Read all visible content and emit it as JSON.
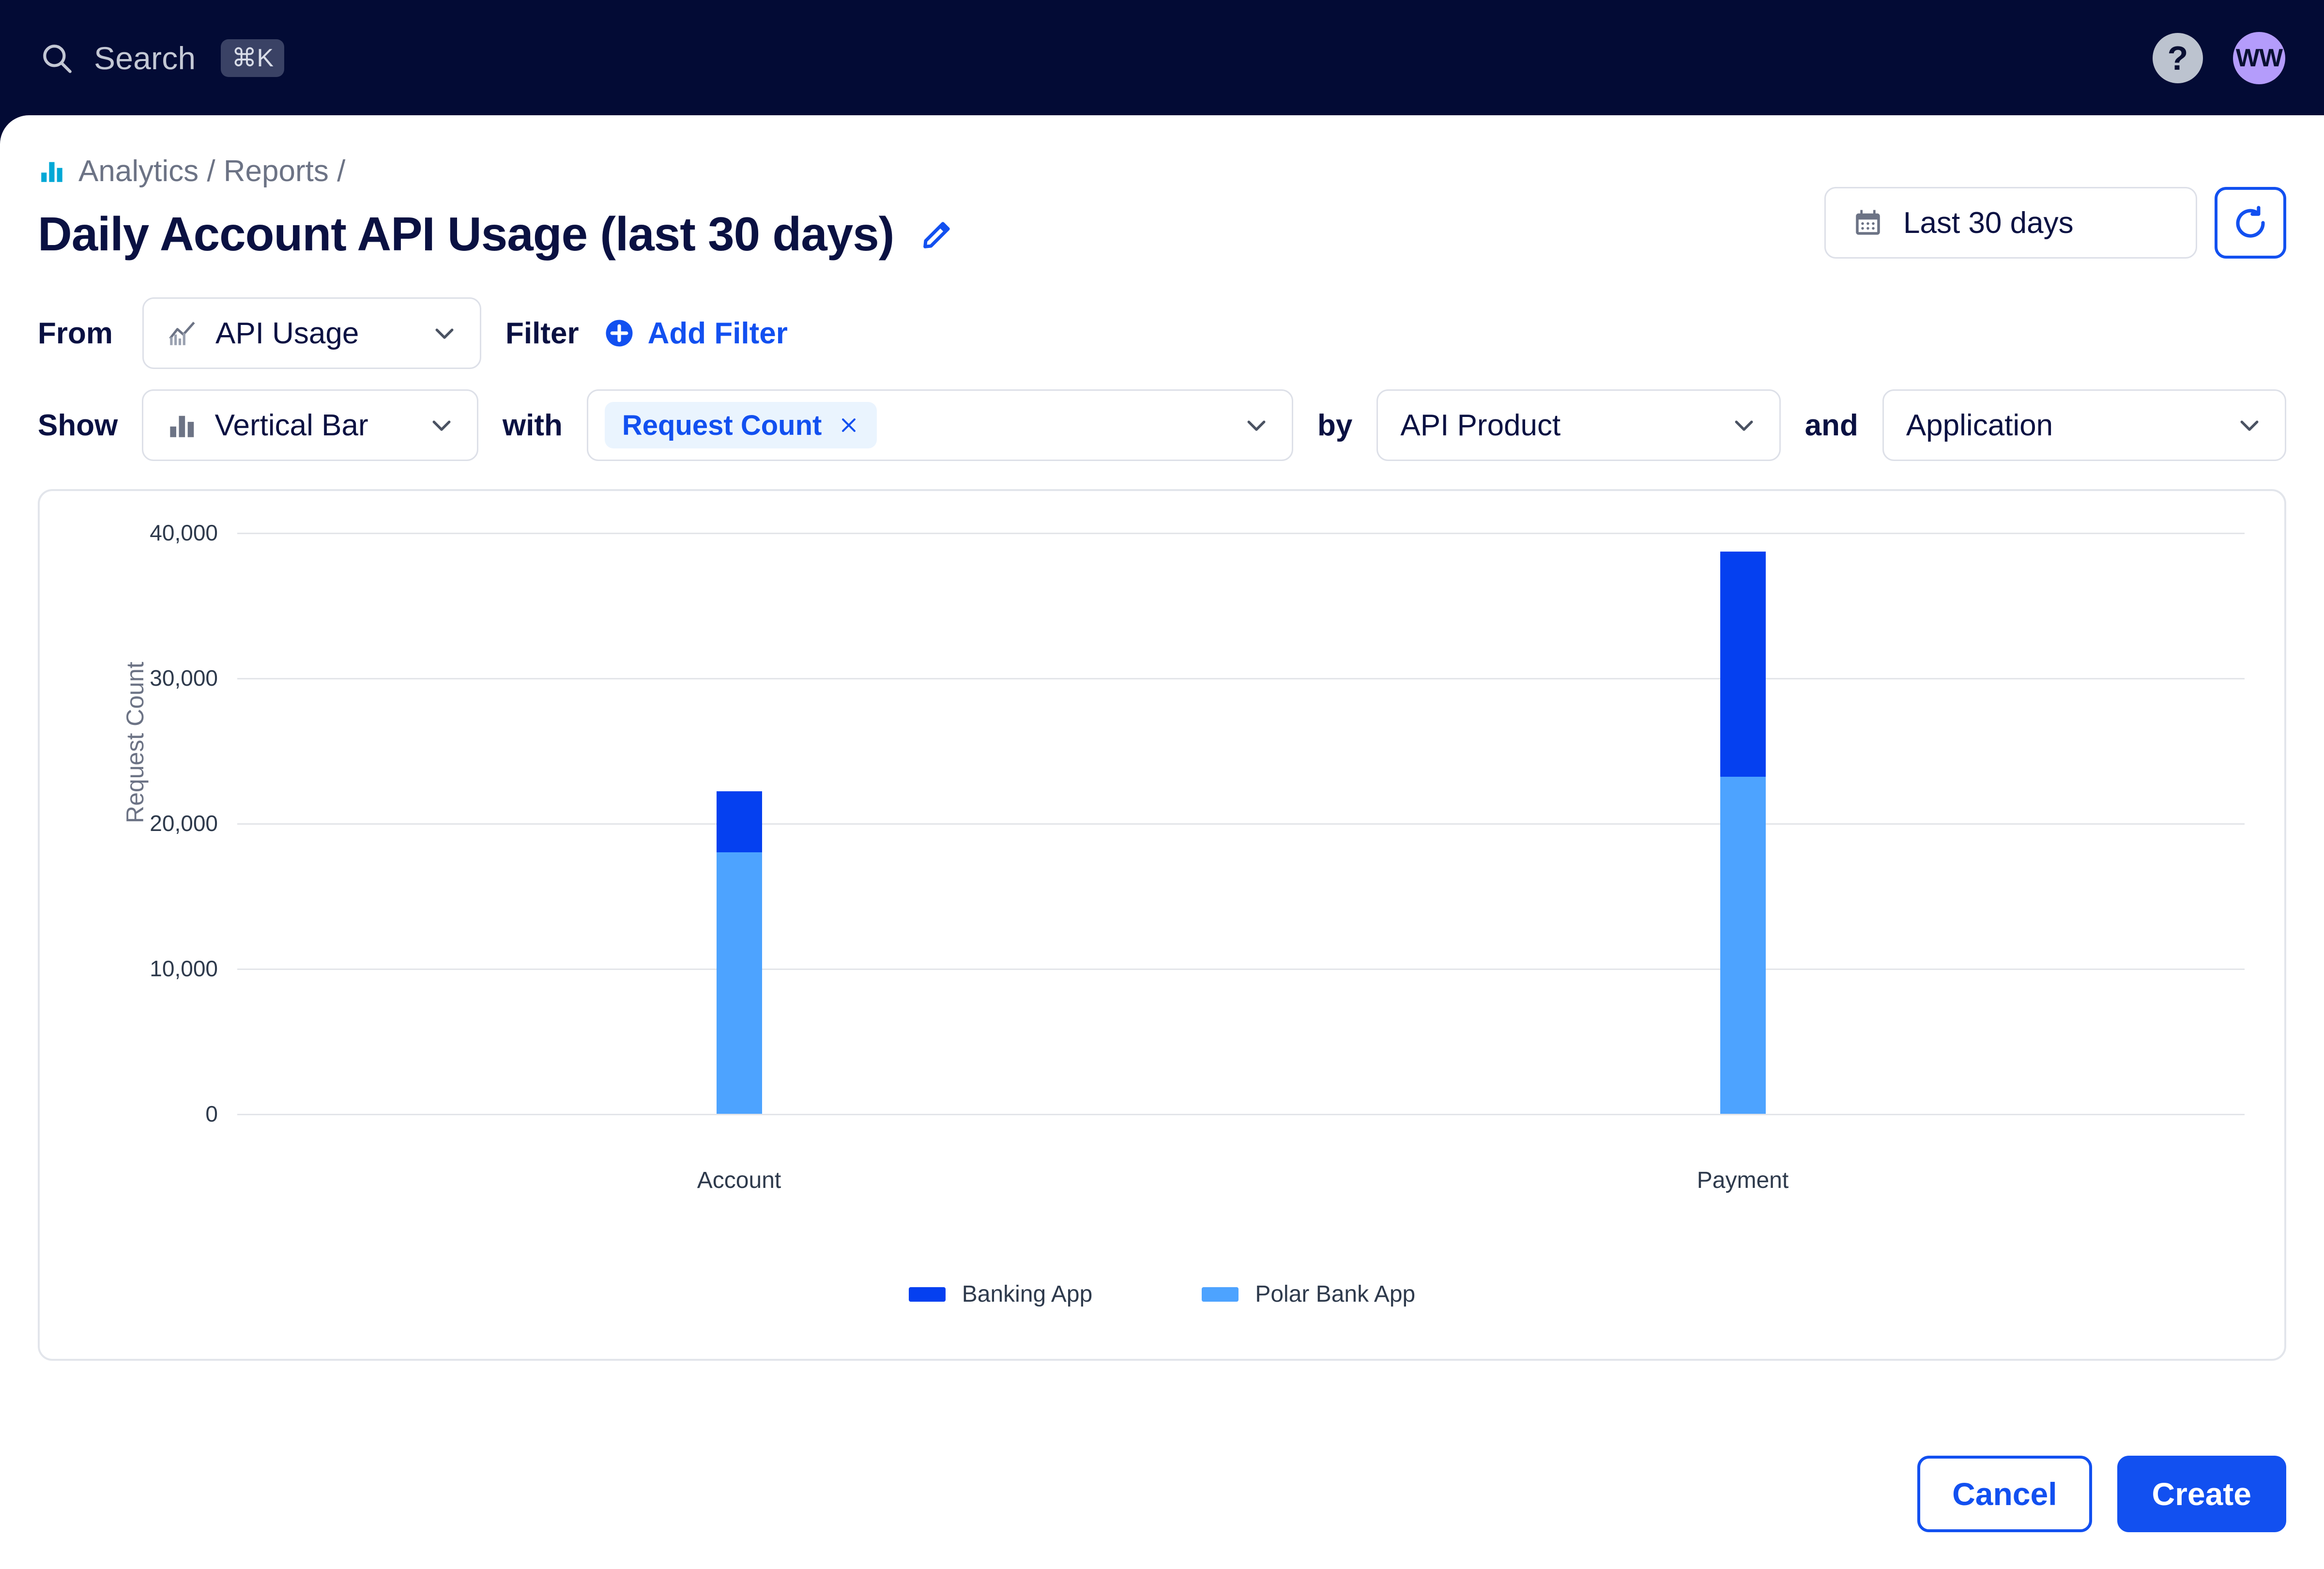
{
  "topbar": {
    "search_label": "Search",
    "search_icon": "search-icon",
    "shortcut": "⌘K",
    "help_icon": "?",
    "avatar_initials": "WW",
    "bg_color": "#030B35",
    "avatar_color": "#B49CFB"
  },
  "breadcrumb": {
    "icon": "bar-chart-icon",
    "text": "Analytics / Reports /"
  },
  "header": {
    "title": "Daily Account API Usage (last 30 days)",
    "edit_icon": "pencil-icon",
    "date_range": "Last 30 days",
    "calendar_icon": "calendar-icon",
    "refresh_icon": "refresh-icon"
  },
  "builder": {
    "from_label": "From",
    "source_value": "API Usage",
    "source_icon": "line-chart-icon",
    "filter_label": "Filter",
    "add_filter_label": "Add Filter",
    "add_filter_icon": "plus-circle-icon",
    "show_label": "Show",
    "chart_type_value": "Vertical Bar",
    "chart_type_icon": "bar-chart-icon",
    "with_label": "with",
    "metric_chip": "Request Count",
    "metric_chip_remove": "×",
    "by_label": "by",
    "group_value": "API Product",
    "and_label": "and",
    "group2_value": "Application"
  },
  "footer": {
    "cancel_label": "Cancel",
    "create_label": "Create"
  },
  "chart_data": {
    "type": "bar",
    "stacked": true,
    "title": "",
    "xlabel": "",
    "ylabel": "Request Count",
    "categories": [
      "Account",
      "Payment"
    ],
    "ytick_labels": [
      "0",
      "10,000",
      "20,000",
      "30,000",
      "40,000"
    ],
    "ytick_values": [
      0,
      10000,
      20000,
      30000,
      40000
    ],
    "ylim": [
      0,
      40000
    ],
    "grid": true,
    "legend_position": "bottom",
    "series": [
      {
        "name": "Polar Bank App",
        "color": "#4DA3FF",
        "values": [
          18000,
          23200
        ]
      },
      {
        "name": "Banking App",
        "color": "#0540F0",
        "values": [
          4200,
          15500
        ]
      }
    ],
    "totals": [
      22200,
      38700
    ]
  }
}
